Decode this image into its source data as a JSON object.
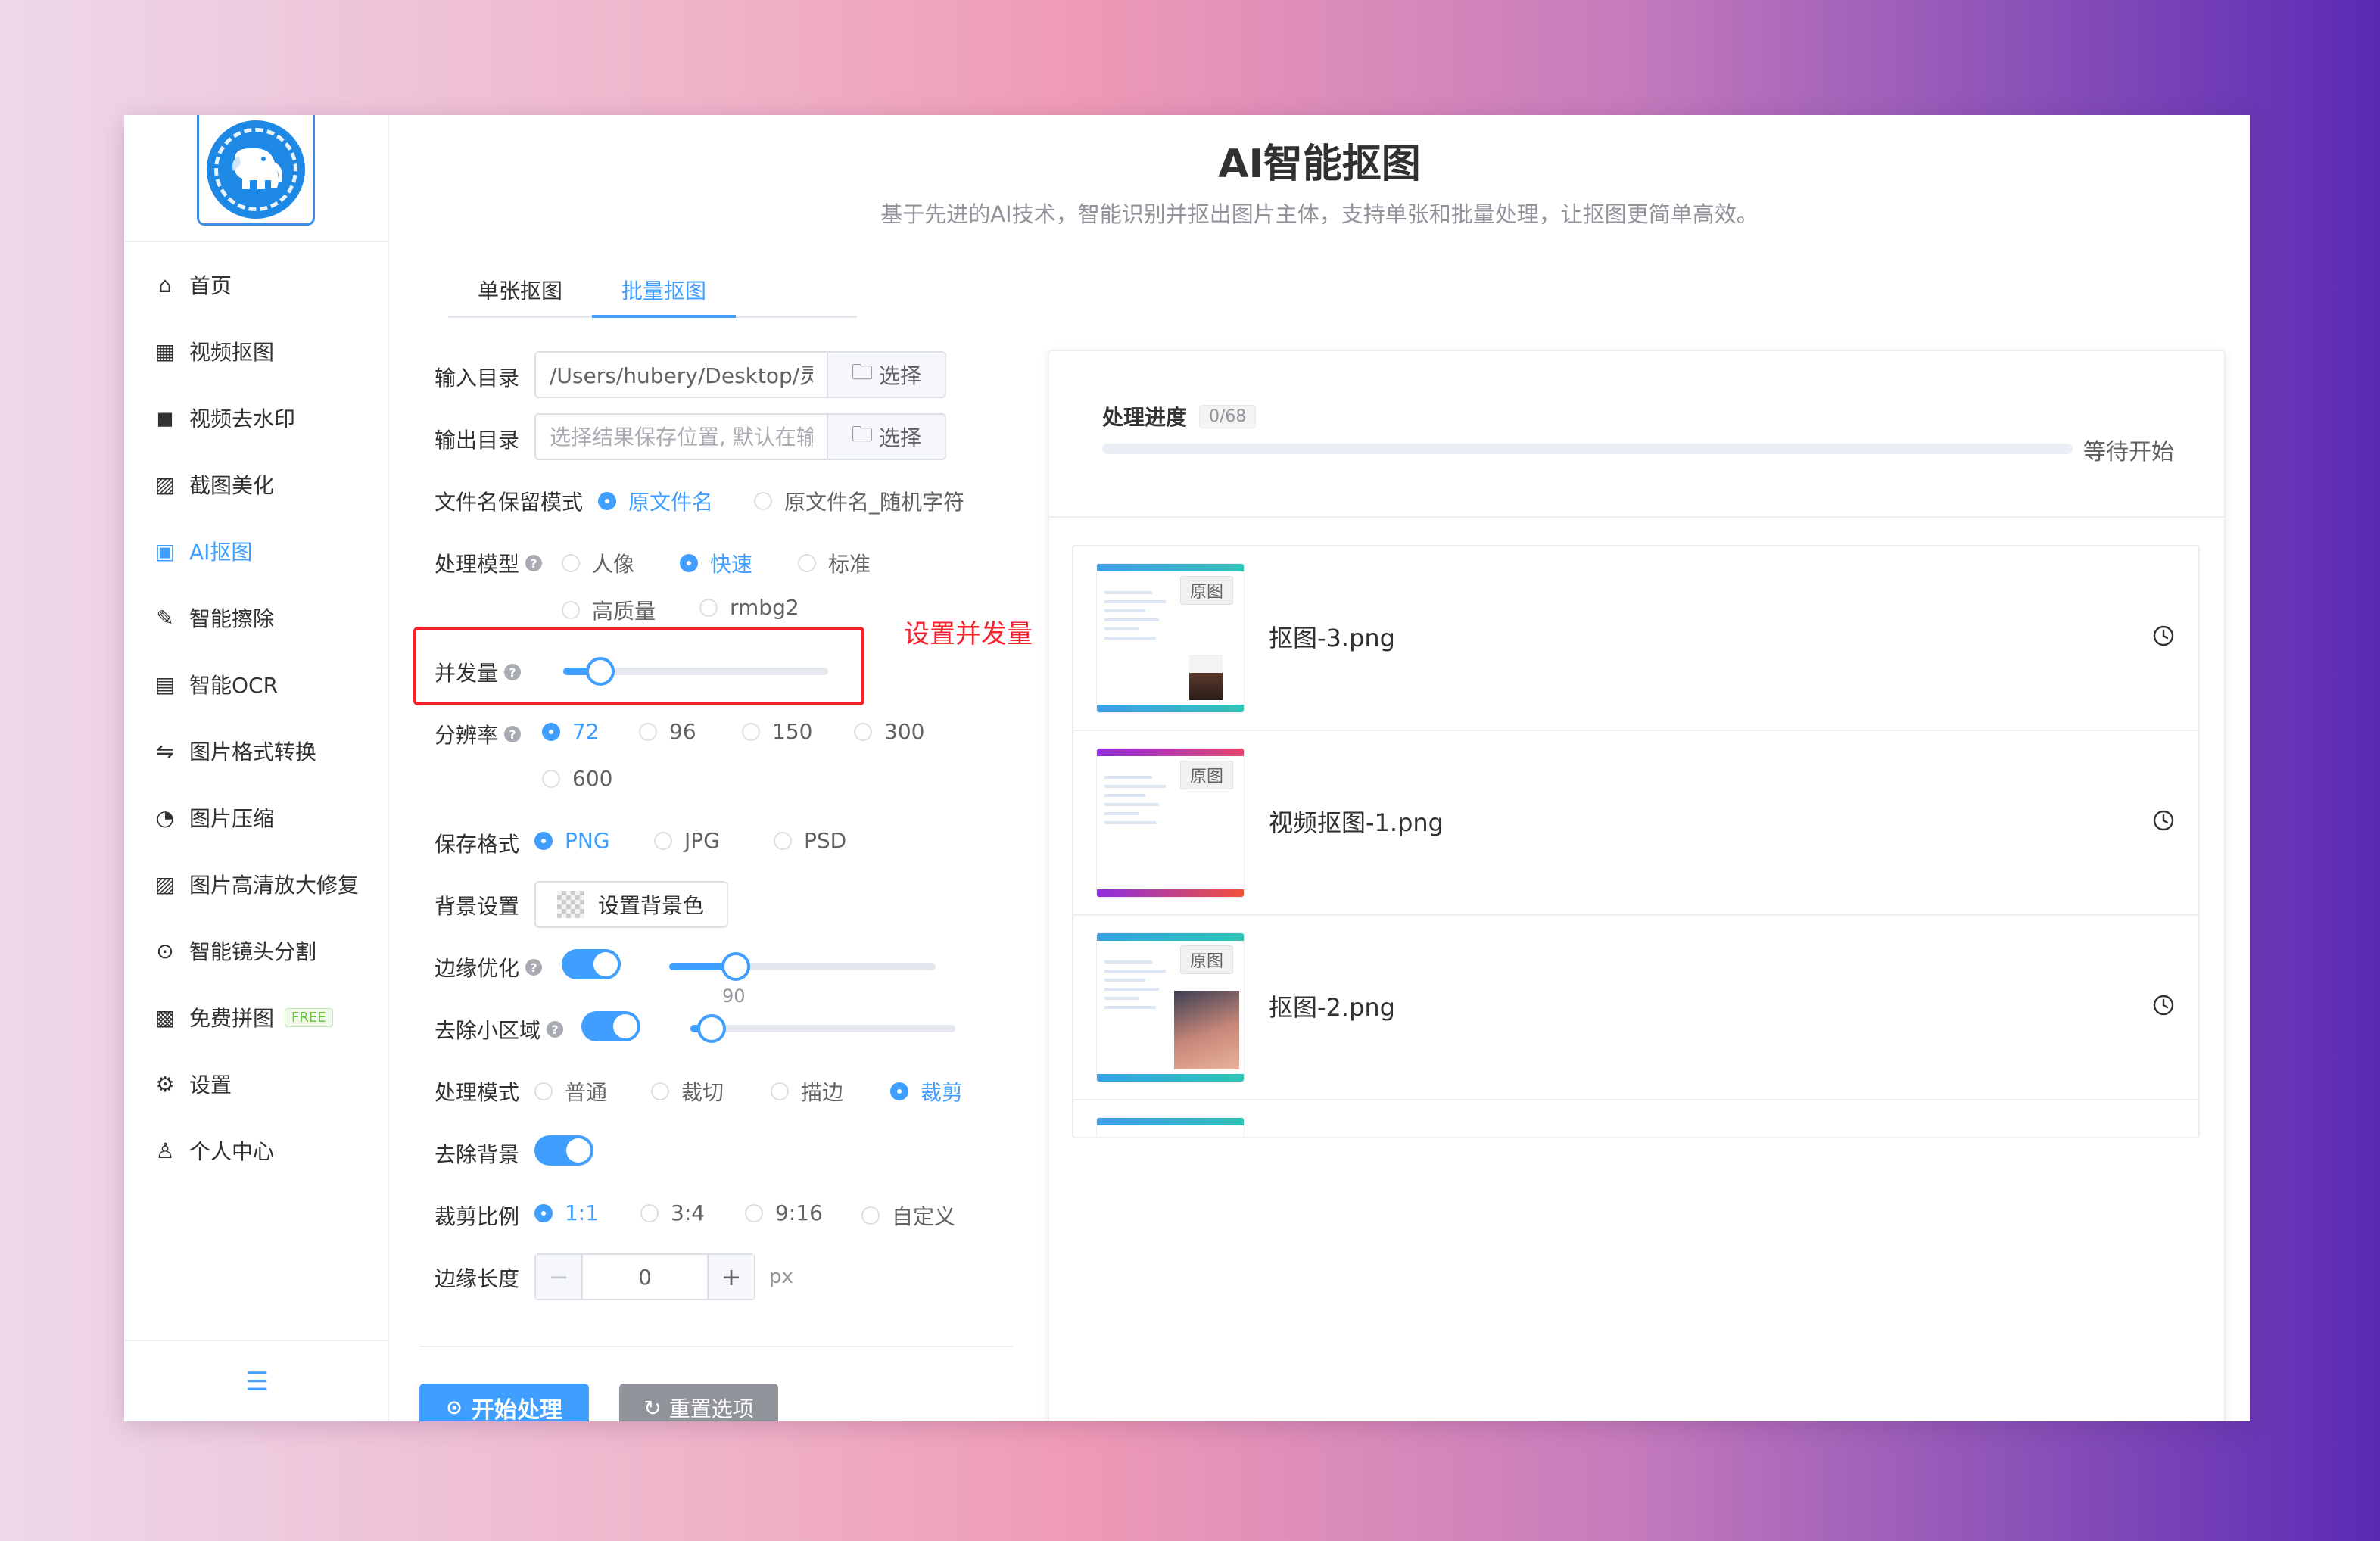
{
  "sidebar": {
    "items": [
      {
        "label": "首页",
        "icon": "home-icon"
      },
      {
        "label": "视频抠图",
        "icon": "grid-icon"
      },
      {
        "label": "视频去水印",
        "icon": "camera-icon"
      },
      {
        "label": "截图美化",
        "icon": "image-icon"
      },
      {
        "label": "AI抠图",
        "icon": "picture-icon"
      },
      {
        "label": "智能擦除",
        "icon": "eraser-icon"
      },
      {
        "label": "智能OCR",
        "icon": "document-icon"
      },
      {
        "label": "图片格式转换",
        "icon": "convert-icon"
      },
      {
        "label": "图片压缩",
        "icon": "compress-icon"
      },
      {
        "label": "图片高清放大修复",
        "icon": "image-icon"
      },
      {
        "label": "智能镜头分割",
        "icon": "play-circle-icon"
      },
      {
        "label": "免费拼图",
        "icon": "apps-icon",
        "badge": "FREE"
      },
      {
        "label": "设置",
        "icon": "gear-icon"
      },
      {
        "label": "个人中心",
        "icon": "user-icon"
      }
    ],
    "active_index": 4
  },
  "header": {
    "title": "AI智能抠图",
    "subtitle": "基于先进的AI技术，智能识别并抠出图片主体，支持单张和批量处理，让抠图更简单高效。"
  },
  "tabs": [
    {
      "label": "单张抠图",
      "active": false
    },
    {
      "label": "批量抠图",
      "active": true
    }
  ],
  "form": {
    "input_dir": {
      "label": "输入目录",
      "value": "/Users/hubery/Desktop/灵象",
      "button": "选择"
    },
    "output_dir": {
      "label": "输出目录",
      "placeholder": "选择结果保存位置, 默认在输入目录",
      "button": "选择"
    },
    "filename_mode": {
      "label": "文件名保留模式",
      "options": [
        "原文件名",
        "原文件名_随机字符"
      ],
      "selected": "原文件名"
    },
    "model": {
      "label": "处理模型",
      "options": [
        "人像",
        "快速",
        "标准",
        "高质量",
        "rmbg2"
      ],
      "selected": "快速"
    },
    "concurrency": {
      "label": "并发量",
      "value_fraction": 0.14
    },
    "resolution": {
      "label": "分辨率",
      "options": [
        "72",
        "96",
        "150",
        "300",
        "600"
      ],
      "selected": "72"
    },
    "save_format": {
      "label": "保存格式",
      "options": [
        "PNG",
        "JPG",
        "PSD"
      ],
      "selected": "PNG"
    },
    "background": {
      "label": "背景设置",
      "button": "设置背景色"
    },
    "edge_optimize": {
      "label": "边缘优化",
      "enabled": true,
      "value_fraction": 0.25
    },
    "remove_small": {
      "label": "去除小区域",
      "enabled": true,
      "value": "90",
      "value_fraction": 0.08
    },
    "process_mode": {
      "label": "处理模式",
      "options": [
        "普通",
        "裁切",
        "描边",
        "裁剪"
      ],
      "selected": "裁剪"
    },
    "remove_bg": {
      "label": "去除背景",
      "enabled": true
    },
    "crop_ratio": {
      "label": "裁剪比例",
      "options": [
        "1:1",
        "3:4",
        "9:16",
        "自定义"
      ],
      "selected": "1:1"
    },
    "edge_length": {
      "label": "边缘长度",
      "value": "0",
      "unit": "px"
    }
  },
  "annotation": "设置并发量",
  "buttons": {
    "start": "开始处理",
    "reset": "重置选项"
  },
  "progress": {
    "label": "处理进度",
    "count": "0/68",
    "status": "等待开始",
    "fraction": 0
  },
  "files": [
    {
      "name": "抠图-3.png",
      "tag": "原图",
      "theme": "teal"
    },
    {
      "name": "视频抠图-1.png",
      "tag": "原图",
      "theme": "sunset"
    },
    {
      "name": "抠图-2.png",
      "tag": "原图",
      "theme": "teal"
    }
  ],
  "colors": {
    "primary": "#409eff",
    "annotation": "#f5222d",
    "free_badge": "#67c23a"
  }
}
